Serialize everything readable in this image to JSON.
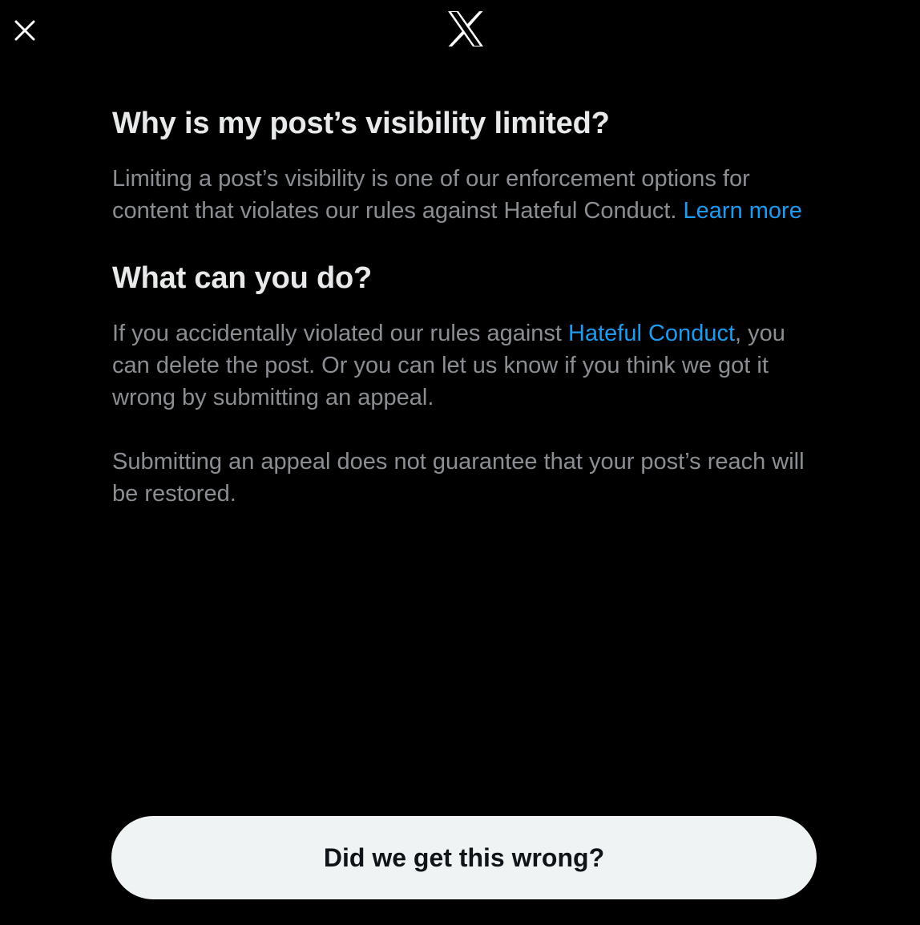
{
  "header": {
    "close_icon": "close-icon",
    "logo_icon": "x-logo-icon"
  },
  "section_why": {
    "title": "Why is my post’s visibility limited?",
    "body": "Limiting a post’s visibility is one of our enforcement options for content that violates our rules against Hateful Conduct. ",
    "link": "Learn more"
  },
  "section_what": {
    "title": "What can you do?",
    "body_before": "If you accidentally violated our rules against ",
    "link": "Hateful Conduct",
    "body_after": ", you can delete the post. Or you can let us know if you think we got it wrong by submitting an appeal.",
    "note": "Submitting an appeal does not guarantee that your post’s reach will be restored."
  },
  "footer": {
    "appeal_button": "Did we get this wrong?"
  },
  "colors": {
    "background": "#000000",
    "heading": "#e7e9ea",
    "body_text": "#8b8f94",
    "link": "#1d9bf0",
    "button_bg": "#eff3f4",
    "button_text": "#0f1419"
  }
}
